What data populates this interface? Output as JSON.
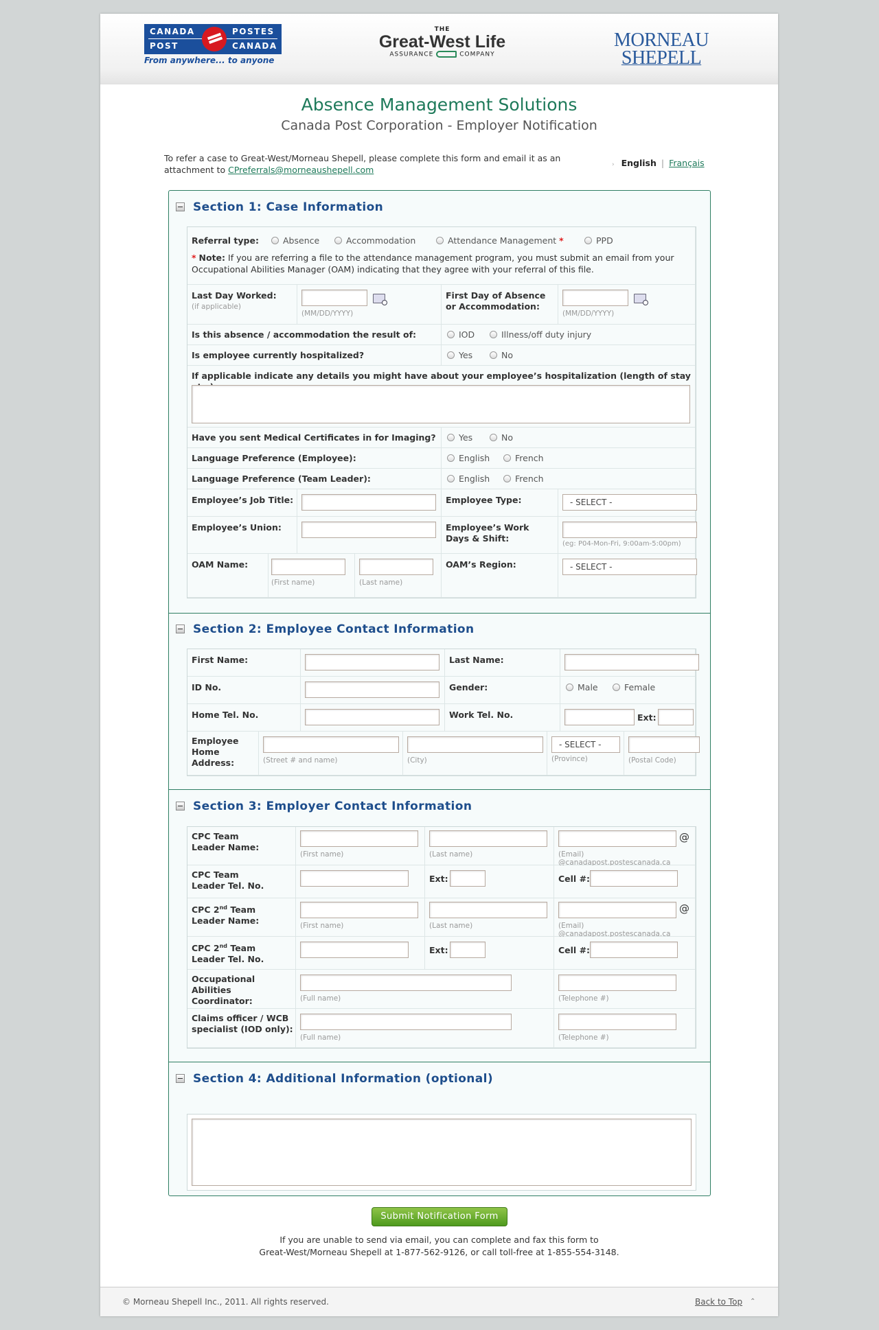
{
  "header": {
    "canada_post": {
      "canada": "CANADA",
      "postes": "POSTES",
      "post": "POST",
      "canada2": "CANADA",
      "tagline": "From anywhere... to anyone"
    },
    "gwl": {
      "the": "THE",
      "name": "Great-West Life",
      "assurance": "ASSURANCE",
      "company": "COMPANY"
    },
    "morneau": {
      "line1": "MORNEAU",
      "line2": "SHEPELL"
    }
  },
  "titles": {
    "main": "Absence Management Solutions",
    "sub": "Canada Post Corporation - Employer Notification"
  },
  "intro": {
    "text": "To refer a case to Great-West/Morneau Shepell, please complete this form and email it as an attachment to",
    "email": "CPreferrals@morneaushepell.com"
  },
  "lang": {
    "arrow": "›",
    "current": "English",
    "separator": "|",
    "other": "Français"
  },
  "sections": {
    "s1": {
      "title": "Section 1: Case Information",
      "referral_label": "Referral type:",
      "referral_options": [
        "Absence",
        "Accommodation",
        "Attendance Management",
        "PPD"
      ],
      "note_star": "*",
      "note_label": "Note:",
      "note_text": "If you are referring a file to the attendance management program, you must submit an email from your Occupational Abilities Manager (OAM) indicating that they agree with your referral of this file.",
      "last_day_label": "Last Day Worked:",
      "last_day_hint": "(if applicable)",
      "date_hint": "(MM/DD/YYYY)",
      "first_day_label_1": "First Day of Absence",
      "first_day_label_2": "or Accommodation:",
      "result_label": "Is this absence / accommodation the result of:",
      "result_options": [
        "IOD",
        "Illness/off duty injury"
      ],
      "hosp_label": "Is employee currently hospitalized?",
      "yes": "Yes",
      "no": "No",
      "hosp_details_label": "If applicable indicate any details you might have about your employee’s hospitalization (length of stay etc.):",
      "med_cert_label": "Have you sent Medical Certificates in for Imaging?",
      "lang_emp_label": "Language Preference (Employee):",
      "lang_tl_label": "Language Preference (Team Leader):",
      "english": "English",
      "french": "French",
      "job_title_label": "Employee’s Job Title:",
      "emp_type_label": "Employee Type:",
      "select_placeholder": "- SELECT -",
      "union_label": "Employee’s Union:",
      "work_days_label_1": "Employee’s Work",
      "work_days_label_2": "Days & Shift:",
      "work_days_hint": "(eg: P04-Mon-Fri, 9:00am-5:00pm)",
      "oam_name_label": "OAM Name:",
      "first_name_hint": "(First name)",
      "last_name_hint": "(Last name)",
      "oam_region_label": "OAM’s Region:"
    },
    "s2": {
      "title": "Section 2: Employee Contact Information",
      "first_name_label": "First Name:",
      "last_name_label": "Last Name:",
      "id_label": "ID No.",
      "gender_label": "Gender:",
      "male": "Male",
      "female": "Female",
      "home_tel_label": "Home Tel. No.",
      "work_tel_label": "Work Tel. No.",
      "ext_label": "Ext:",
      "address_label_1": "Employee",
      "address_label_2": "Home",
      "address_label_3": "Address:",
      "street_hint": "(Street # and name)",
      "city_hint": "(City)",
      "province_select": "- SELECT -",
      "province_hint": "(Province)",
      "postal_hint": "(Postal Code)"
    },
    "s3": {
      "title": "Section 3: Employer Contact Information",
      "tl_name_1": "CPC Team",
      "tl_name_2": "Leader Name:",
      "first_name_hint": "(First name)",
      "last_name_hint": "(Last name)",
      "email_hint": "(Email) @canadapost.postescanada.ca",
      "at": "@",
      "tl_tel_1": "CPC Team",
      "tl_tel_2": "Leader Tel. No.",
      "ext_label": "Ext:",
      "cell_label": "Cell #:",
      "tl2_name_1a": "CPC 2",
      "tl2_sup": "nd",
      "tl2_name_1b": " Team",
      "tl2_name_2": "Leader Name:",
      "tl2_tel_2": "Leader Tel. No.",
      "oac_1": "Occupational Abilities",
      "oac_2": "Coordinator:",
      "full_name_hint": "(Full name)",
      "telephone_hint": "(Telephone #)",
      "claims_1": "Claims officer / WCB",
      "claims_2": "specialist (IOD only):"
    },
    "s4": {
      "title": "Section 4: Additional Information (optional)"
    }
  },
  "submit_label": "Submit Notification Form",
  "fax": {
    "line1": "If you are unable to send via email, you can complete and fax this form to",
    "line2": "Great-West/Morneau Shepell at 1-877-562-9126, or call toll-free at 1-855-554-3148."
  },
  "footer": {
    "copyright": "© Morneau Shepell Inc., 2011. All rights reserved.",
    "back_to_top": "Back to Top"
  }
}
